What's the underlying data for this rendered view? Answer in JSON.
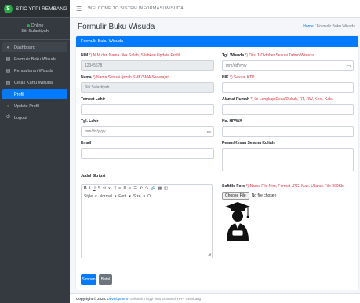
{
  "brand": {
    "logo": "S",
    "name": "STIC YPPI REMBANG"
  },
  "user": {
    "status": "Online",
    "name": "Siti Sulastiyah"
  },
  "sidebar": {
    "items": [
      {
        "label": "Dashboard",
        "icon": "dashboard-icon"
      },
      {
        "label": "Formulir Buku Wisuda",
        "icon": "form-icon"
      },
      {
        "label": "Pendaftaran Wisuda",
        "icon": "register-icon"
      },
      {
        "label": "Cetak Kartu Wisuda",
        "icon": "print-icon"
      },
      {
        "label": "Profil",
        "icon": "user-icon"
      },
      {
        "label": "Update Profil",
        "icon": "refresh-icon"
      },
      {
        "label": "Logout",
        "icon": "logout-icon"
      }
    ]
  },
  "topbar": {
    "title": "WELCOME TO SISTEM INFORMASI WISUDA"
  },
  "header": {
    "title": "Formulir Buku Wisuda",
    "breadcrumb_home": "Home",
    "breadcrumb_sep": "/",
    "breadcrumb_current": "Formulir Buku Wisuda"
  },
  "card": {
    "title": "Formulir Buku Wisuda"
  },
  "form": {
    "nim": {
      "label": "NIM",
      "hint": "*) NIM dan Nama Jika Salah, Silahkan Update Profil",
      "value": "12345678"
    },
    "nama": {
      "label": "Nama",
      "hint": "*) Nama Sesuai Ijazah SMK/SMA Sederajat",
      "value": "Siti Sulastiyah"
    },
    "tempat_lahir": {
      "label": "Tempat Lahir",
      "value": ""
    },
    "tgl_lahir": {
      "label": "Tgl. Lahir",
      "placeholder": "mm/dd/yyyy"
    },
    "email": {
      "label": "Email",
      "value": ""
    },
    "judul": {
      "label": "Judul Skripsi"
    },
    "tgl_wisuda": {
      "label": "Tgl. Wisuda",
      "hint": "*) Diisi 1 Oktober Sesuai Tahun Wisuda",
      "placeholder": "mm/dd/yyyy"
    },
    "nik": {
      "label": "NIK",
      "hint": "*) Sesuai KTP",
      "value": ""
    },
    "alamat": {
      "label": "Alamat Rumah",
      "hint": "*) Isi Lengkap Desa/Dukuh, RT, RW, Kec., Kab.",
      "value": ""
    },
    "hp": {
      "label": "No. HP/WA",
      "value": ""
    },
    "pesan": {
      "label": "Pesan/Kesan Selama Kuliah"
    },
    "foto": {
      "label": "Softfile Foto",
      "hint": "*) Nama File Nim, Format JPG, Max. Ukuran File 200Kb",
      "button": "Choose File",
      "status": "No file chosen"
    }
  },
  "editor": {
    "row1": [
      "B",
      "I",
      "U",
      "S",
      "x²",
      "x₂",
      "¶",
      "≡",
      "≣",
      "≡",
      "☰",
      "↶",
      "↷",
      "🔗",
      "▦",
      "◫"
    ],
    "row2": [
      "Style",
      "Normal",
      "Font",
      "Size",
      "Ω"
    ]
  },
  "buttons": {
    "save": "Simpan",
    "cancel": "Batal"
  },
  "footer": {
    "prefix": "Copyright © 2020.",
    "org": "Development",
    "suffix": " - Sekolah Tinggi Ilmu Ekonomi YPPI Rembang"
  },
  "colors": {
    "primary": "#007bff",
    "sidebar": "#343a40",
    "danger": "#dc3545",
    "success": "#28a745"
  }
}
